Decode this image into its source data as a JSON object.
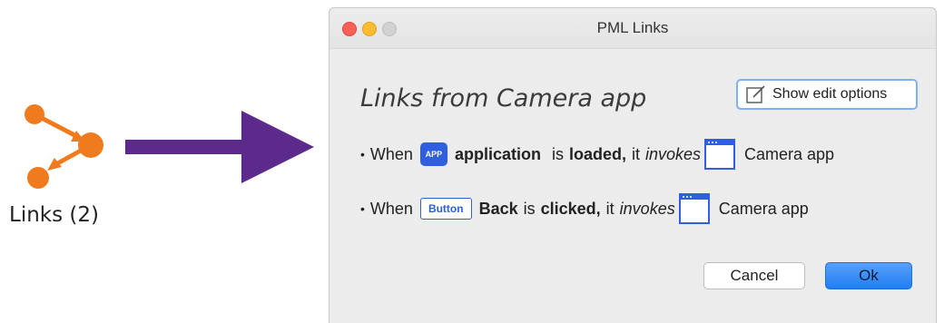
{
  "links_panel": {
    "caption": "Links (2)",
    "icon": "links-icon",
    "icon_color": "#f07b1f"
  },
  "arrow": {
    "icon": "right-arrow",
    "color": "#5b2a8c"
  },
  "dialog": {
    "title": "PML Links",
    "heading": "Links from Camera app",
    "edit_button_label": "Show edit options",
    "rules": [
      {
        "prefix": "When",
        "badge": "APP",
        "element": "application",
        "is": "is",
        "action": "loaded,",
        "it": "it",
        "verb": "invokes",
        "target": "Camera app"
      },
      {
        "prefix": "When",
        "badge": "Button",
        "element": "Back",
        "is": "is",
        "action": "clicked,",
        "it": "it",
        "verb": "invokes",
        "target": "Camera app"
      }
    ],
    "cancel_label": "Cancel",
    "ok_label": "Ok"
  },
  "colors": {
    "accent_blue": "#2f5fe0",
    "ok_blue": "#1f7ef5"
  }
}
